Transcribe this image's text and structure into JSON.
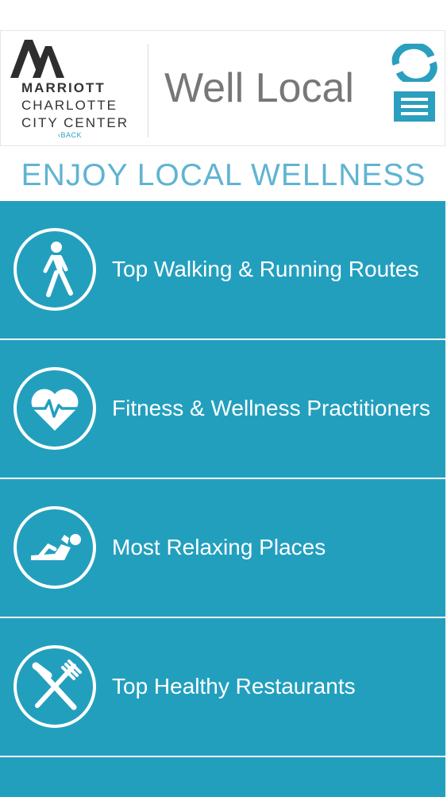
{
  "header": {
    "brand": {
      "name": "MARRIOTT",
      "location_line1": "CHARLOTTE",
      "location_line2": "CITY CENTER",
      "back_label": "‹BACK"
    },
    "app_title": "Well Local",
    "icons": {
      "refresh": "refresh-icon",
      "menu": "hamburger-menu-icon"
    },
    "accent_color": "#2a9fbf"
  },
  "page_heading": "ENJOY LOCAL WELLNESS",
  "tiles": [
    {
      "label": "Top Walking & Running Routes",
      "icon": "walking-person-icon"
    },
    {
      "label": "Fitness & Wellness Practitioners",
      "icon": "heartbeat-icon"
    },
    {
      "label": "Most Relaxing Places",
      "icon": "relaxing-person-icon"
    },
    {
      "label": "Top Healthy Restaurants",
      "icon": "fork-knife-icon"
    }
  ],
  "colors": {
    "tile_background": "#239fbe",
    "heading": "#5fb4d2",
    "title": "#777777"
  }
}
